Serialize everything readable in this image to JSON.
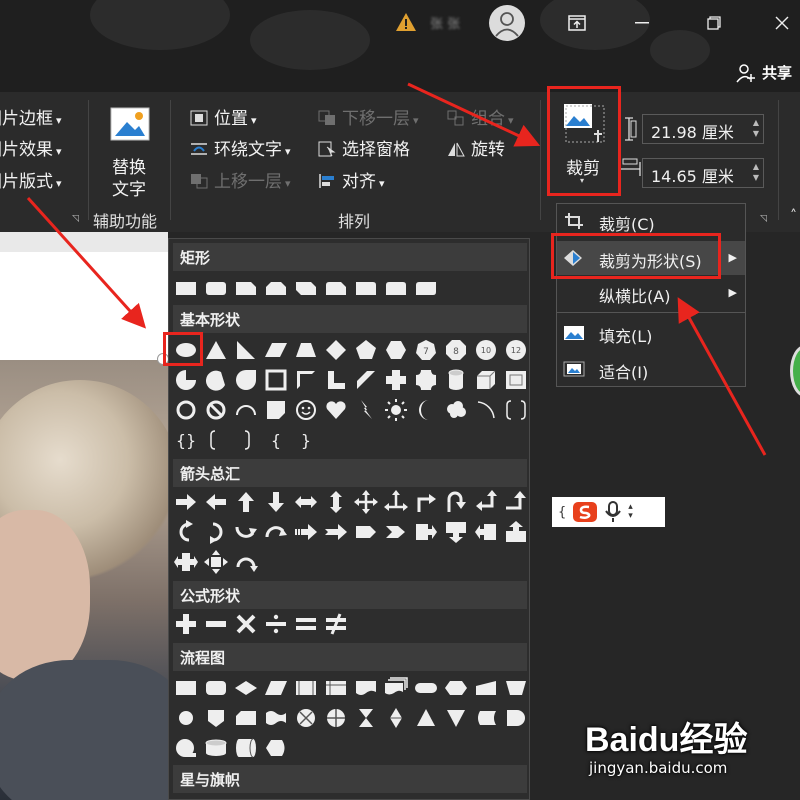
{
  "title_bar": {
    "title_text": "张 张",
    "share_label": "共享"
  },
  "ribbon": {
    "picture_styles": {
      "border_label": "图片边框",
      "effects_label": "图片效果",
      "layout_label": "图片版式"
    },
    "accessibility": {
      "alt_text_label_line1": "替换",
      "alt_text_label_line2": "文字",
      "group_label": "辅助功能"
    },
    "arrange": {
      "position_label": "位置",
      "wrap_text_label": "环绕文字",
      "bring_forward_label": "上移一层",
      "send_backward_label": "下移一层",
      "selection_pane_label": "选择窗格",
      "align_label": "对齐",
      "group_label_btn": "组合",
      "rotate_label": "旋转",
      "group_label": "排列"
    },
    "size": {
      "crop_label": "裁剪",
      "height_value": "21.98 厘米",
      "width_value": "14.65 厘米"
    }
  },
  "crop_menu": {
    "items": [
      {
        "label": "裁剪(C)",
        "icon": "crop-icon",
        "submenu": false
      },
      {
        "label": "裁剪为形状(S)",
        "icon": "crop-to-shape-icon",
        "submenu": true,
        "highlighted": true
      },
      {
        "label": "纵横比(A)",
        "icon": "",
        "submenu": true
      },
      {
        "label": "填充(L)",
        "icon": "fill-icon",
        "submenu": false
      },
      {
        "label": "适合(I)",
        "icon": "fit-icon",
        "submenu": false
      }
    ]
  },
  "shapes_gallery": {
    "categories": [
      {
        "label": "矩形"
      },
      {
        "label": "基本形状"
      },
      {
        "label": "箭头总汇"
      },
      {
        "label": "公式形状"
      },
      {
        "label": "流程图"
      },
      {
        "label": "星与旗帜"
      }
    ],
    "selected_shape": "oval"
  },
  "watermark": {
    "logo": "Baidu经验",
    "url": "jingyan.baidu.com"
  },
  "colors": {
    "annotation_red": "#e8251e",
    "ribbon_bg": "#2b2b2b",
    "gallery_bg": "#2d2d2d",
    "menu_highlight": "#474747"
  }
}
